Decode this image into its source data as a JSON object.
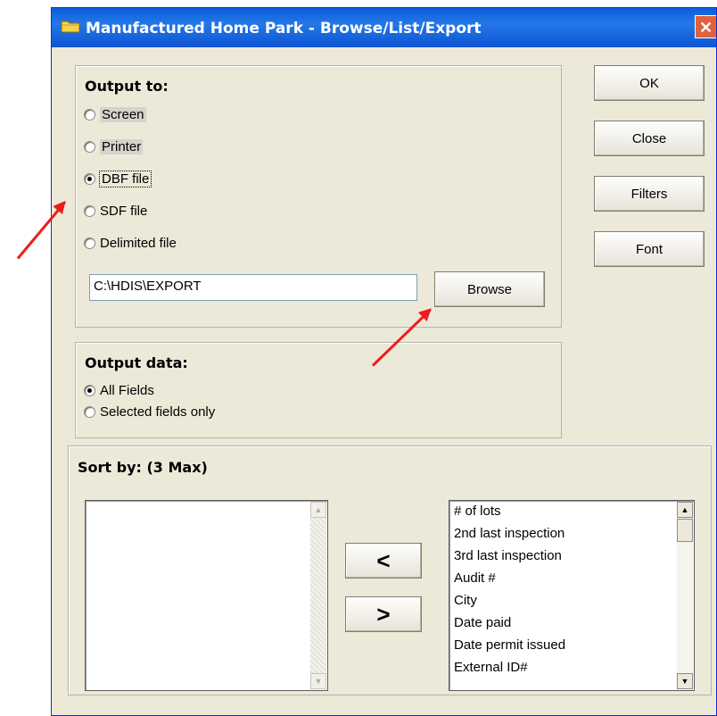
{
  "window": {
    "title": "Manufactured Home Park - Browse/List/Export",
    "close_glyph": "✕"
  },
  "output_to": {
    "title": "Output to:",
    "options": [
      "Screen",
      "Printer",
      "DBF file",
      "SDF file",
      "Delimited file"
    ],
    "selected": "DBF file",
    "path_value": "C:\\HDIS\\EXPORT",
    "browse_label": "Browse"
  },
  "output_data": {
    "title": "Output data:",
    "options": [
      "All Fields",
      "Selected fields only"
    ],
    "selected": "All Fields"
  },
  "buttons": {
    "ok": "OK",
    "close": "Close",
    "filters": "Filters",
    "font": "Font"
  },
  "sort_by": {
    "title": "Sort by: (3 Max)",
    "add_label": "<",
    "remove_label": ">",
    "selected_fields": [],
    "available_fields": [
      "# of lots",
      "2nd last inspection",
      "3rd last inspection",
      "Audit #",
      "City",
      "Date paid",
      "Date permit issued",
      "External ID#"
    ]
  },
  "colors": {
    "titlebar": "#0a5fd8",
    "dialog_bg": "#ece9d8",
    "annotation_arrow": "#ee1c1c"
  }
}
